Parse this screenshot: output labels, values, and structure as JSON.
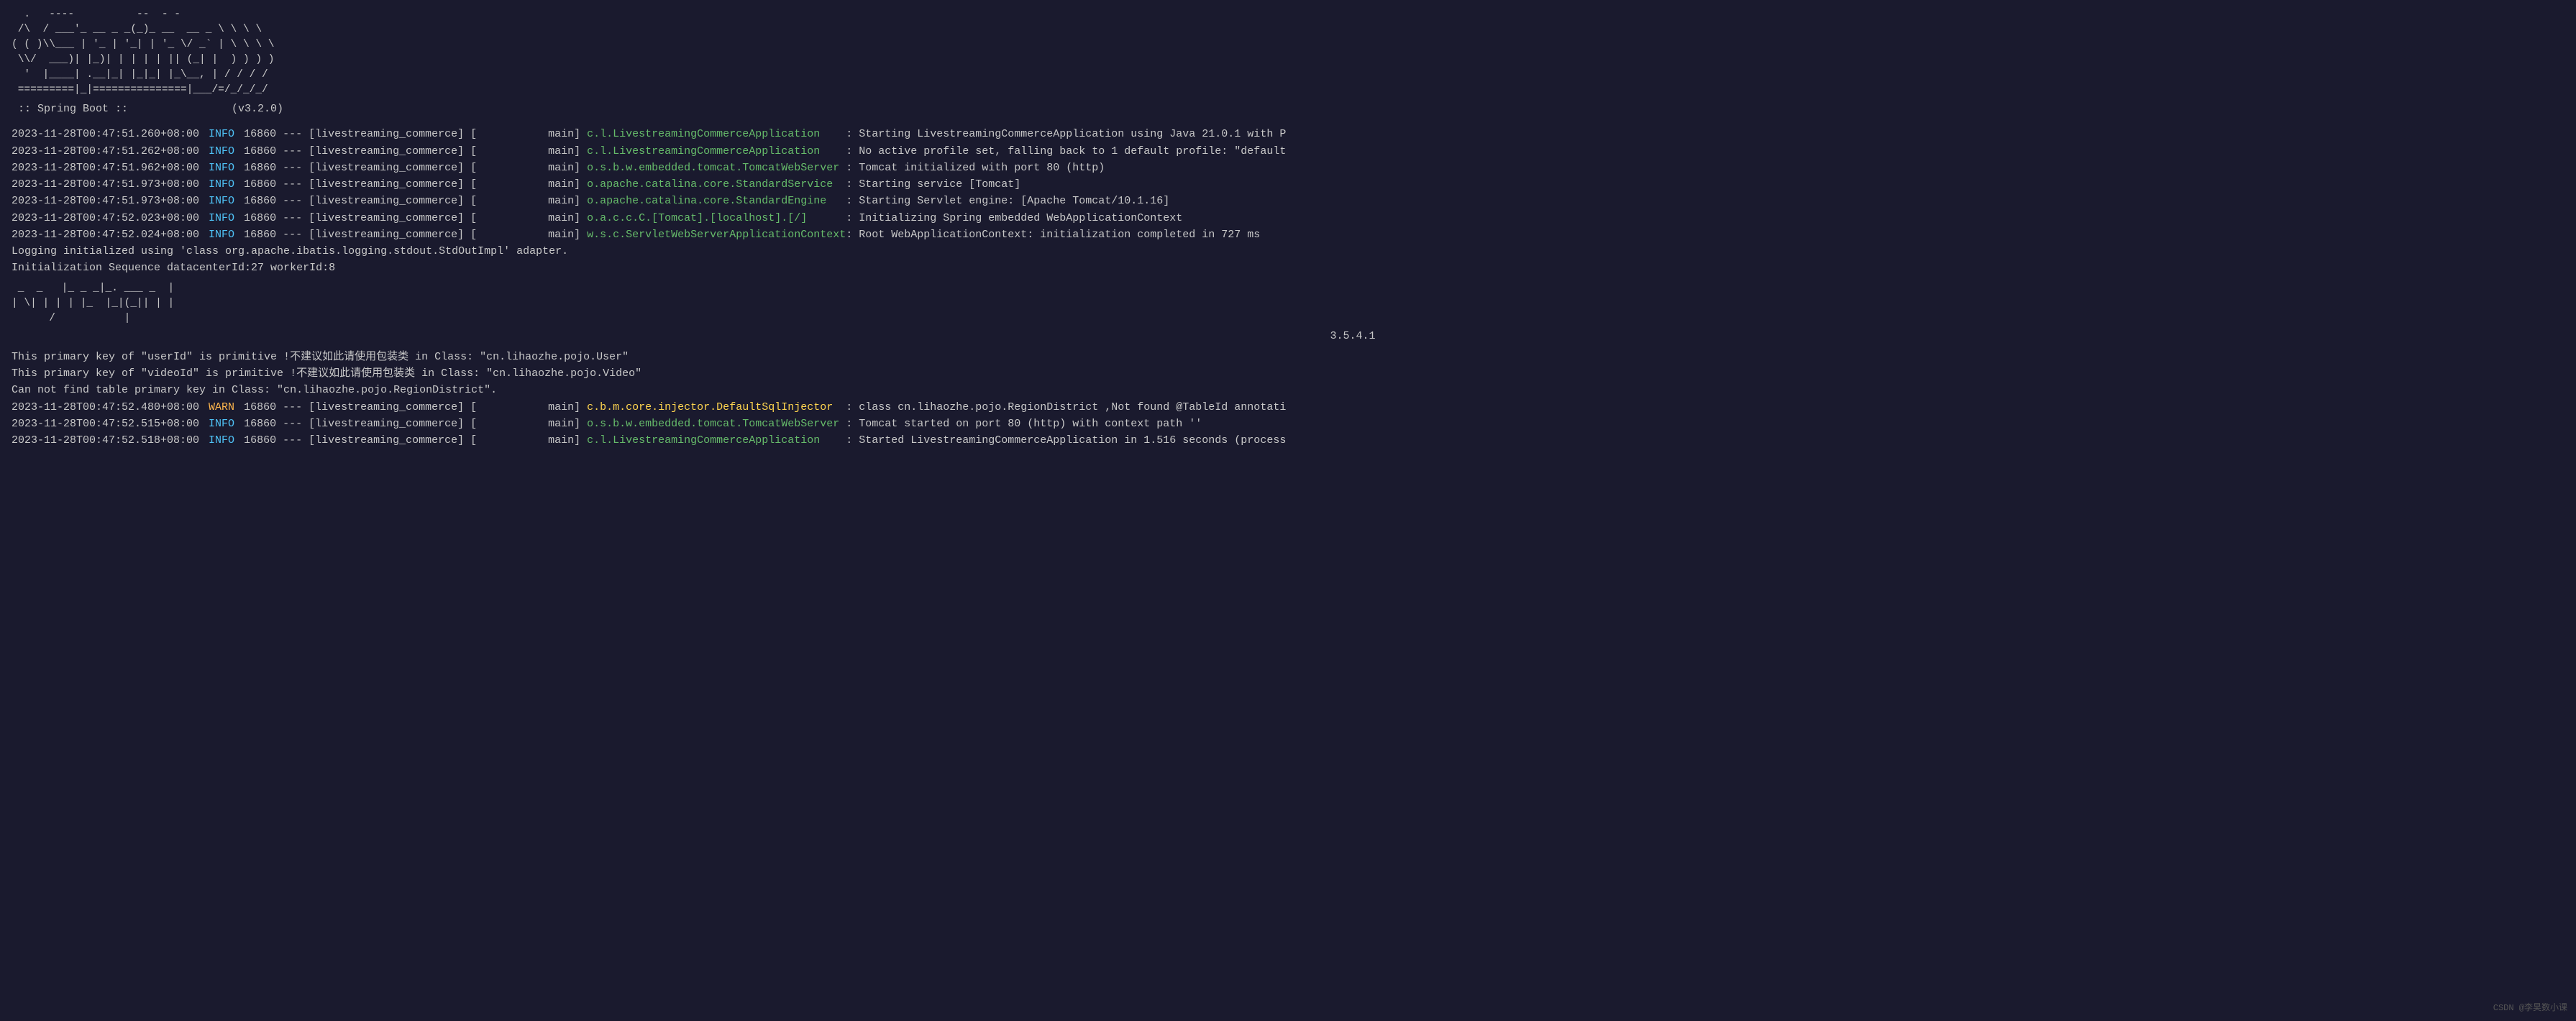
{
  "console": {
    "background": "#1a1a2e",
    "watermark": "CSDN @李昊数小课",
    "ascii_art_spring": [
      "  .   ----          --  - -",
      " /\\  / ___'_ __ _ _(_)_ __  __ _ \\ \\ \\ \\",
      "( ( )\\___ | '_ | '_| | '_ \\/ _` | \\ \\ \\ \\",
      " \\\\/  ___)| |_)| | | | | || (_| |  ) ) ) )",
      "  '  |____| .__|_| |_|_| |_\\__, | / / / /",
      " =========|_|===============|___/=/_/_/_/"
    ],
    "spring_version_line": " :: Spring Boot ::                (v3.2.0)",
    "log_entries": [
      {
        "timestamp": "2023-11-28T00:47:51.260+08:00",
        "level": "INFO",
        "pid": "16860",
        "separator": "---",
        "app": "[livestreaming_commerce]",
        "thread": "[           main]",
        "logger": "c.l.LivestreamingCommerceApplication",
        "logger_color": "green",
        "message": ": Starting LivestreamingCommerceApplication using Java 21.0.1 with P"
      },
      {
        "timestamp": "2023-11-28T00:47:51.262+08:00",
        "level": "INFO",
        "pid": "16860",
        "separator": "---",
        "app": "[livestreaming_commerce]",
        "thread": "[           main]",
        "logger": "c.l.LivestreamingCommerceApplication",
        "logger_color": "green",
        "message": ": No active profile set, falling back to 1 default profile: \"default"
      },
      {
        "timestamp": "2023-11-28T00:47:51.962+08:00",
        "level": "INFO",
        "pid": "16860",
        "separator": "---",
        "app": "[livestreaming_commerce]",
        "thread": "[           main]",
        "logger": "o.s.b.w.embedded.tomcat.TomcatWebServer",
        "logger_color": "green",
        "message": ": Tomcat initialized with port 80 (http)"
      },
      {
        "timestamp": "2023-11-28T00:47:51.973+08:00",
        "level": "INFO",
        "pid": "16860",
        "separator": "---",
        "app": "[livestreaming_commerce]",
        "thread": "[           main]",
        "logger": "o.apache.catalina.core.StandardService",
        "logger_color": "green",
        "message": ": Starting service [Tomcat]"
      },
      {
        "timestamp": "2023-11-28T00:47:51.973+08:00",
        "level": "INFO",
        "pid": "16860",
        "separator": "---",
        "app": "[livestreaming_commerce]",
        "thread": "[           main]",
        "logger": "o.apache.catalina.core.StandardEngine",
        "logger_color": "green",
        "message": ": Starting Servlet engine: [Apache Tomcat/10.1.16]"
      },
      {
        "timestamp": "2023-11-28T00:47:52.023+08:00",
        "level": "INFO",
        "pid": "16860",
        "separator": "---",
        "app": "[livestreaming_commerce]",
        "thread": "[           main]",
        "logger": "o.a.c.c.C.[Tomcat].[localhost].[/]",
        "logger_color": "green",
        "message": ": Initializing Spring embedded WebApplicationContext"
      },
      {
        "timestamp": "2023-11-28T00:47:52.024+08:00",
        "level": "INFO",
        "pid": "16860",
        "separator": "---",
        "app": "[livestreaming_commerce]",
        "thread": "[           main]",
        "logger": "w.s.c.ServletWebServerApplicationContext",
        "logger_color": "green",
        "message": ": Root WebApplicationContext: initialization completed in 727 ms"
      }
    ],
    "plain_lines": [
      "Logging initialized using 'class org.apache.ibatis.logging.stdout.StdOutImpl' adapter.",
      "Initialization Sequence datacenterId:27 workerId:8"
    ],
    "mybatis_ascii": [
      " _  _   |_ _ _|_. ___ _  |",
      "| \\| | | | |_  |_|(_|| | |",
      "      /           |"
    ],
    "mybatis_version": "                    3.5.4.1",
    "warning_lines": [
      "This primary key of \"userId\" is primitive !不建议如此请使用包装类 in Class: \"cn.lihaozhe.pojo.User\"",
      "This primary key of \"videoId\" is primitive !不建议如此请使用包装类 in Class: \"cn.lihaozhe.pojo.Video\"",
      "Can not find table primary key in Class: \"cn.lihaozhe.pojo.RegionDistrict\"."
    ],
    "log_entries_2": [
      {
        "timestamp": "2023-11-28T00:47:52.480+08:00",
        "level": "WARN",
        "pid": "16860",
        "separator": "---",
        "app": "[livestreaming_commerce]",
        "thread": "[           main]",
        "logger": "c.b.m.core.injector.DefaultSqlInjector",
        "logger_color": "yellow",
        "message": ": class cn.lihaozhe.pojo.RegionDistrict ,Not found @TableId annotati"
      },
      {
        "timestamp": "2023-11-28T00:47:52.515+08:00",
        "level": "INFO",
        "pid": "16860",
        "separator": "---",
        "app": "[livestreaming_commerce]",
        "thread": "[           main]",
        "logger": "o.s.b.w.embedded.tomcat.TomcatWebServer",
        "logger_color": "green",
        "message": ": Tomcat started on port 80 (http) with context path ''"
      },
      {
        "timestamp": "2023-11-28T00:47:52.518+08:00",
        "level": "INFO",
        "pid": "16860",
        "separator": "---",
        "app": "[livestreaming_commerce]",
        "thread": "[           main]",
        "logger": "c.l.LivestreamingCommerceApplication",
        "logger_color": "green",
        "message": ": Started LivestreamingCommerceApplication in 1.516 seconds (process"
      }
    ]
  }
}
